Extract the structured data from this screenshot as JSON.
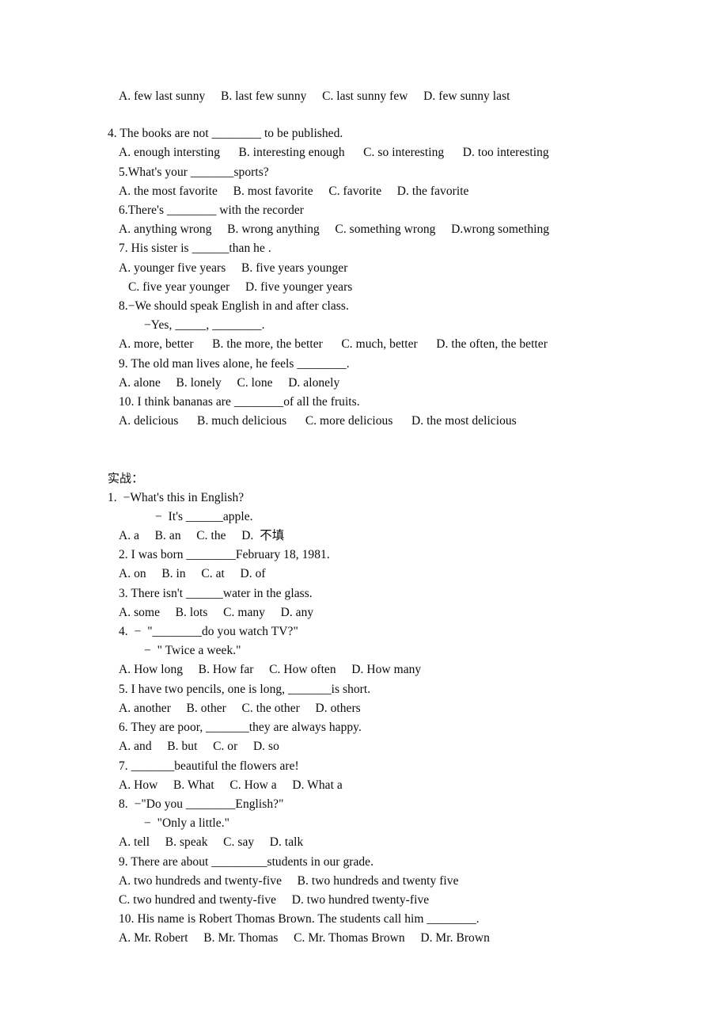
{
  "document": {
    "type": "english-grammar-worksheet",
    "background_color": "#ffffff",
    "text_color": "#0b0b0b"
  },
  "section_one": {
    "orphan_options_line": "A. few last sunny     B. last few sunny     C. last sunny few     D. few sunny last",
    "questions": [
      {
        "stem": "4. The books are not ________ to be published.",
        "options": "A. enough intersting      B. interesting enough      C. so interesting      D. too interesting"
      },
      {
        "stem": "5.What's your _______sports?",
        "options": "A. the most favorite     B. most favorite     C. favorite     D. the favorite"
      },
      {
        "stem": "6.There's ________ with the recorder",
        "options": "A. anything wrong     B. wrong anything     C. something wrong     D.wrong something"
      },
      {
        "stem": "7. His sister is ______than he .",
        "options_a": "A. younger five years     B. five years younger",
        "options_b": "C. five year younger     D. five younger years"
      },
      {
        "stem": "8.−We should speak English in and after class.",
        "stem_reply": "−Yes, _____, ________.",
        "options": "A. more, better      B. the more, the better      C. much, better      D. the often, the better"
      },
      {
        "stem": "9. The old man lives alone, he feels ________.",
        "options": "A. alone     B. lonely     C. lone     D. alonely"
      },
      {
        "stem": "10. I think bananas are ________of all the fruits.",
        "options": "A. delicious      B. much delicious      C. more delicious      D. the most delicious"
      }
    ]
  },
  "section_two": {
    "heading": "实战：",
    "questions": [
      {
        "stem": "1.  −What's this in English?",
        "stem_reply": "−  It's ______apple.",
        "options": "A. a     B. an     C. the     D.  不填"
      },
      {
        "stem": "2. I was born ________February 18, 1981.",
        "options": "A. on     B. in     C. at     D. of"
      },
      {
        "stem": "3. There isn't ______water in the glass.",
        "options": "A. some     B. lots     C. many     D. any"
      },
      {
        "stem": "4.  −  \"________do you watch TV?\"",
        "stem_reply": "−  \" Twice a week.\"",
        "options": "A. How long     B. How far     C. How often     D. How many"
      },
      {
        "stem": "5. I have two pencils, one is long, _______is short.",
        "options": "A. another     B. other     C. the other     D. others"
      },
      {
        "stem": "6. They are poor, _______they are always happy.",
        "options": "A. and     B. but     C. or     D. so"
      },
      {
        "stem": "7. _______beautiful the flowers are!",
        "options": "A. How     B. What     C. How a     D. What a"
      },
      {
        "stem": "8.  −\"Do you ________English?\"",
        "stem_reply": "−  \"Only a little.\"",
        "options": "A. tell     B. speak     C. say     D. talk"
      },
      {
        "stem": "9. There are about _________students in our grade.",
        "options_a": "A. two hundreds and twenty-five     B. two hundreds and twenty five",
        "options_b": "C. two hundred and twenty-five     D. two hundred twenty-five"
      },
      {
        "stem": "10. His name is Robert Thomas Brown. The students call him ________.",
        "options": "A. Mr. Robert     B. Mr. Thomas     C. Mr. Thomas Brown     D. Mr. Brown"
      }
    ]
  }
}
